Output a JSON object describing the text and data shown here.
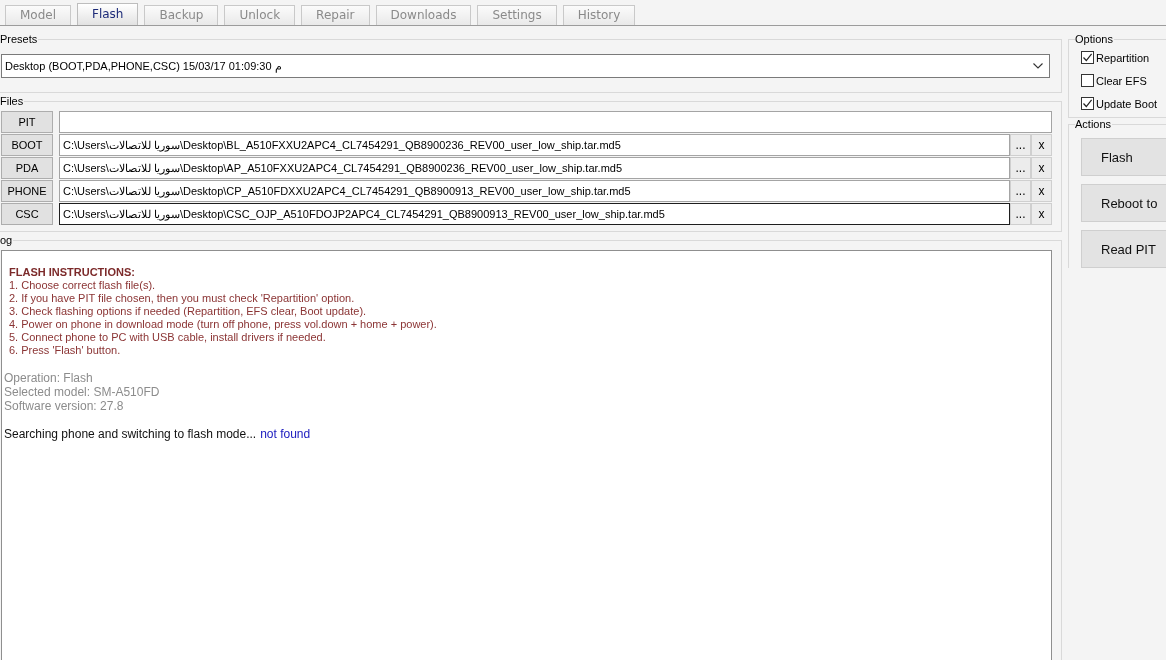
{
  "tabs": [
    {
      "label": "Model",
      "selected": false
    },
    {
      "label": "Flash",
      "selected": true
    },
    {
      "label": "Backup",
      "selected": false
    },
    {
      "label": "Unlock",
      "selected": false
    },
    {
      "label": "Repair",
      "selected": false
    },
    {
      "label": "Downloads",
      "selected": false
    },
    {
      "label": "Settings",
      "selected": false
    },
    {
      "label": "History",
      "selected": false
    }
  ],
  "presets": {
    "title": "Presets",
    "selection": "Desktop (BOOT,PDA,PHONE,CSC) 15/03/17 01:09:30 م"
  },
  "files": {
    "title": "Files",
    "rows": [
      {
        "label": "PIT",
        "focused": false
      },
      {
        "label": "BOOT",
        "path": "C:\\Users\\سوريا للاتصالات\\Desktop\\BL_A510FXXU2APC4_CL7454291_QB8900236_REV00_user_low_ship.tar.md5",
        "browse_button": "...",
        "clear_button": "x",
        "focused": false
      },
      {
        "label": "PDA",
        "path": "C:\\Users\\سوريا للاتصالات\\Desktop\\AP_A510FXXU2APC4_CL7454291_QB8900236_REV00_user_low_ship.tar.md5",
        "browse_button": "...",
        "clear_button": "x",
        "focused": false
      },
      {
        "label": "PHONE",
        "path": "C:\\Users\\سوريا للاتصالات\\Desktop\\CP_A510FDXXU2APC4_CL7454291_QB8900913_REV00_user_low_ship.tar.md5",
        "browse_button": "...",
        "clear_button": "x",
        "focused": false
      },
      {
        "label": "CSC",
        "path": "C:\\Users\\سوريا للاتصالات\\Desktop\\CSC_OJP_A510FDOJP2APC4_CL7454291_QB8900913_REV00_user_low_ship.tar.md5",
        "browse_button": "...",
        "clear_button": "x",
        "focused": true
      }
    ]
  },
  "log": {
    "title": "og",
    "blocks": [
      {
        "kind": "instructions",
        "heading": "FLASH INSTRUCTIONS:",
        "lines": [
          "1. Choose correct flash file(s).",
          "2. If you have PIT file chosen, then you must check 'Repartition' option.",
          "3. Check flashing options if needed (Repartition, EFS clear, Boot update).",
          "4. Power on phone in download mode (turn off phone, press vol.down + home + power).",
          "5. Connect phone to PC with USB cable, install drivers if needed.",
          "6. Press 'Flash' button."
        ]
      },
      {
        "kind": "info",
        "lines": [
          "Operation: Flash",
          "Selected model: SM-A510FD",
          "Software version: 27.8"
        ]
      },
      {
        "kind": "status",
        "text": "Searching phone and switching to flash mode...",
        "result": "not found"
      }
    ]
  },
  "options": {
    "title": "Options",
    "items": [
      {
        "label": "Repartition",
        "checked": true
      },
      {
        "label": "Clear EFS",
        "checked": false
      },
      {
        "label": "Update Boot",
        "checked": true
      }
    ]
  },
  "actions": {
    "title": "Actions",
    "buttons": [
      "Flash",
      "Reboot to",
      "Read PIT"
    ]
  }
}
